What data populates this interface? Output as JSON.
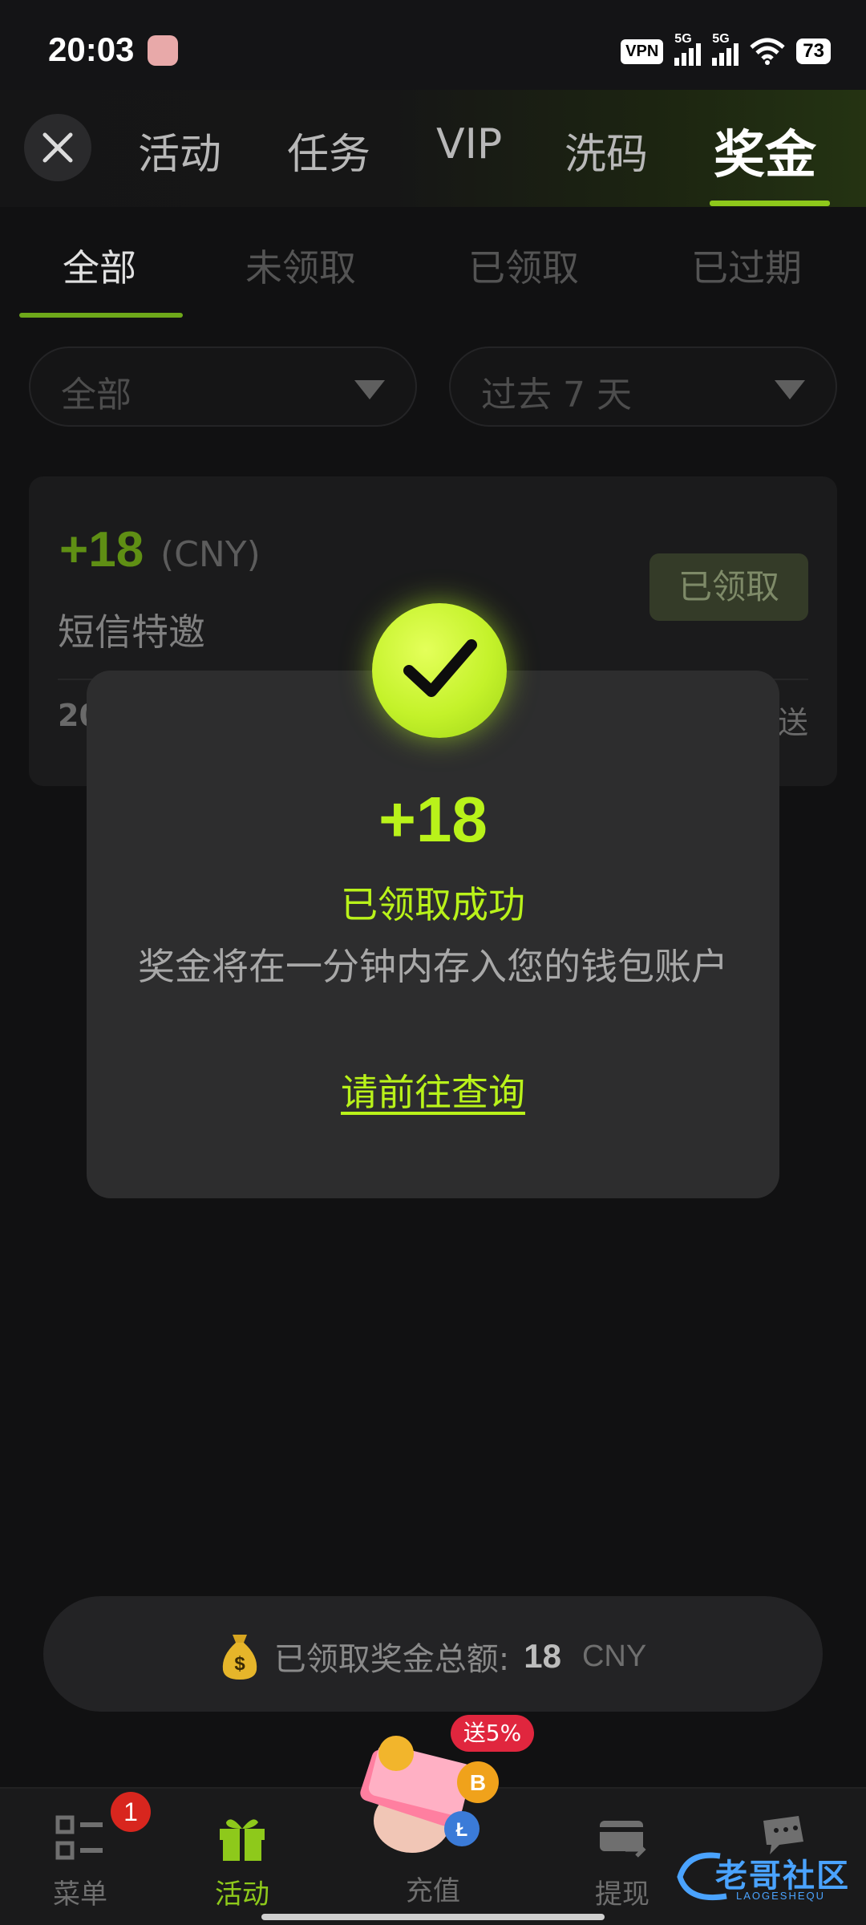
{
  "status_bar": {
    "time": "20:03",
    "vpn": "VPN",
    "network_1": "5G",
    "network_2": "5G",
    "battery": "73"
  },
  "top_nav": {
    "tabs": [
      {
        "label": "活动"
      },
      {
        "label": "任务"
      },
      {
        "label": "VIP"
      },
      {
        "label": "洗码"
      },
      {
        "label": "奖金"
      }
    ],
    "active_tab": "奖金"
  },
  "sub_tabs": {
    "tabs": [
      {
        "label": "全部"
      },
      {
        "label": "未领取"
      },
      {
        "label": "已领取"
      },
      {
        "label": "已过期"
      }
    ],
    "active_tab": "全部"
  },
  "filters": {
    "type_value": "全部",
    "period_value": "过去 7 天"
  },
  "bonus_card": {
    "amount": "+18",
    "currency": "(CNY)",
    "title": "短信特邀",
    "status": "已领取",
    "date_partial": "20",
    "type_partial": "送"
  },
  "modal": {
    "amount": "+18",
    "status": "已领取成功",
    "description": "奖金将在一分钟内存入您的钱包账户",
    "link": "请前往查询"
  },
  "total": {
    "label": "已领取奖金总额:",
    "value": "18",
    "currency": "CNY"
  },
  "bottom_nav": {
    "items": [
      {
        "label": "菜单",
        "icon": "menu-icon",
        "badge": "1"
      },
      {
        "label": "活动",
        "icon": "gift-icon"
      },
      {
        "label": "充值",
        "icon": "deposit-icon",
        "promo": "送5%"
      },
      {
        "label": "提现",
        "icon": "withdraw-icon"
      },
      {
        "label": "",
        "icon": "support-icon"
      }
    ],
    "active": "活动"
  },
  "watermark": {
    "text": "老哥社区",
    "sub": "LAOGESHEQU"
  },
  "colors": {
    "accent": "#b9f21a",
    "accent_dim": "#8ec91b",
    "background": "#111112",
    "modal_bg": "#2d2d2e",
    "badge_red": "#d8261e"
  }
}
